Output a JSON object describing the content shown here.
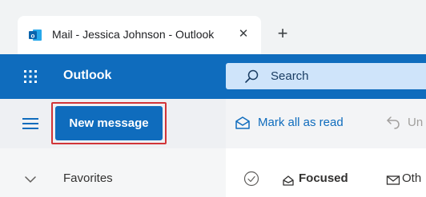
{
  "browser": {
    "tab": {
      "title": "Mail - Jessica Johnson - Outlook",
      "favicon": "outlook-favicon-icon",
      "close": "✕"
    },
    "new_tab": "+"
  },
  "header": {
    "app_name": "Outlook",
    "search_placeholder": "Search",
    "brand_color": "#0f6cbd"
  },
  "commandbar": {
    "new_message_label": "New message",
    "mark_all_read_label": "Mark all as read",
    "undo_label": "Un"
  },
  "nav": {
    "favorites_label": "Favorites"
  },
  "message_list": {
    "focused_label": "Focused",
    "other_label": "Oth"
  }
}
